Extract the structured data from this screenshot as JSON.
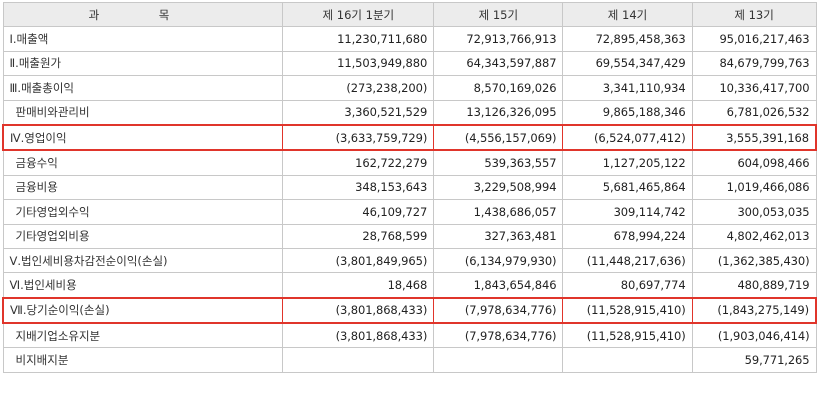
{
  "table": {
    "headers": [
      "과 목",
      "제 16기 1분기",
      "제 15기",
      "제 14기",
      "제 13기"
    ],
    "rows": [
      {
        "label": "Ⅰ.매출액",
        "values": [
          "11,230,711,680",
          "72,913,766,913",
          "72,895,458,363",
          "95,016,217,463"
        ]
      },
      {
        "label": "Ⅱ.매출원가",
        "values": [
          "11,503,949,880",
          "64,343,597,887",
          "69,554,347,429",
          "84,679,799,763"
        ]
      },
      {
        "label": "Ⅲ.매출총이익",
        "values": [
          "(273,238,200)",
          "8,570,169,026",
          "3,341,110,934",
          "10,336,417,700"
        ]
      },
      {
        "label": "판매비와관리비",
        "values": [
          "3,360,521,529",
          "13,126,326,095",
          "9,865,188,346",
          "6,781,026,532"
        ]
      },
      {
        "label": "Ⅳ.영업이익",
        "values": [
          "(3,633,759,729)",
          "(4,556,157,069)",
          "(6,524,077,412)",
          "3,555,391,168"
        ]
      },
      {
        "label": "금융수익",
        "values": [
          "162,722,279",
          "539,363,557",
          "1,127,205,122",
          "604,098,466"
        ]
      },
      {
        "label": "금융비용",
        "values": [
          "348,153,643",
          "3,229,508,994",
          "5,681,465,864",
          "1,019,466,086"
        ]
      },
      {
        "label": "기타영업외수익",
        "values": [
          "46,109,727",
          "1,438,686,057",
          "309,114,742",
          "300,053,035"
        ]
      },
      {
        "label": "기타영업외비용",
        "values": [
          "28,768,599",
          "327,363,481",
          "678,994,224",
          "4,802,462,013"
        ]
      },
      {
        "label": "Ⅴ.법인세비용차감전순이익(손실)",
        "values": [
          "(3,801,849,965)",
          "(6,134,979,930)",
          "(11,448,217,636)",
          "(1,362,385,430)"
        ]
      },
      {
        "label": "Ⅵ.법인세비용",
        "values": [
          "18,468",
          "1,843,654,846",
          "80,697,774",
          "480,889,719"
        ]
      },
      {
        "label": "Ⅶ.당기순이익(손실)",
        "values": [
          "(3,801,868,433)",
          "(7,978,634,776)",
          "(11,528,915,410)",
          "(1,843,275,149)"
        ]
      },
      {
        "label": "지배기업소유지분",
        "values": [
          "(3,801,868,433)",
          "(7,978,634,776)",
          "(11,528,915,410)",
          "(1,903,046,414)"
        ]
      },
      {
        "label": "비지배지분",
        "values": [
          "",
          "",
          "",
          "59,771,265"
        ]
      }
    ]
  },
  "highlight_color": "#e0352b"
}
